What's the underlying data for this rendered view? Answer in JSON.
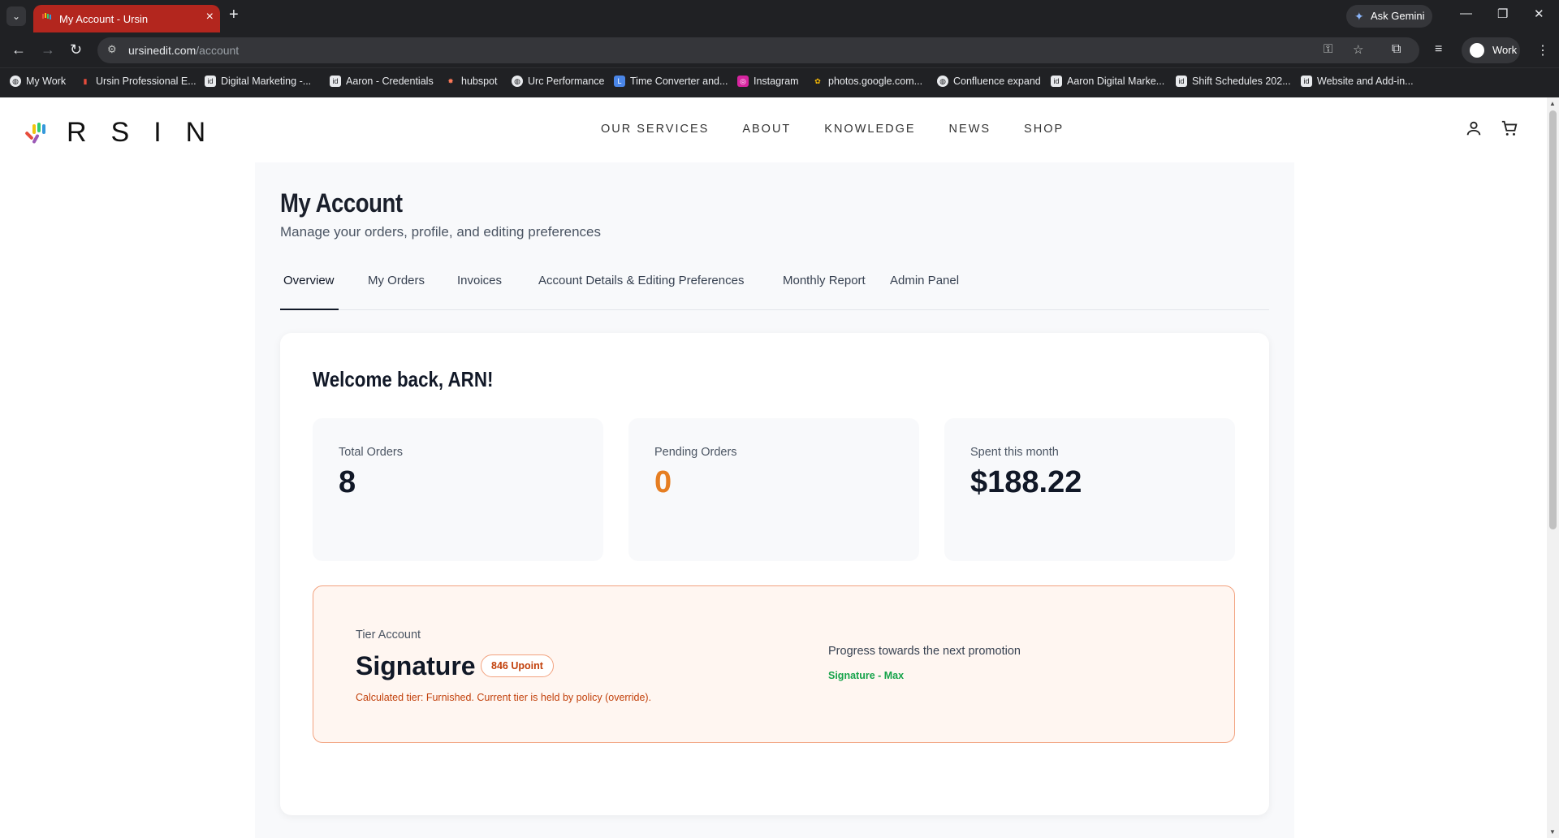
{
  "browser": {
    "tab_title": "My Account - Ursin",
    "ask_gemini": "Ask Gemini",
    "url_host": "ursinedit.com",
    "url_path": "/account",
    "profile_name": "Work",
    "bookmarks": [
      {
        "label": "My Work",
        "icon": "globe-icon"
      },
      {
        "label": "Ursin Professional E...",
        "icon": "ursin-icon"
      },
      {
        "label": "Digital Marketing -...",
        "icon": "doc-icon"
      },
      {
        "label": "Aaron - Credentials",
        "icon": "doc-icon"
      },
      {
        "label": "hubspot",
        "icon": "hubspot-icon"
      },
      {
        "label": "Urc Performance",
        "icon": "globe-icon"
      },
      {
        "label": "Time Converter and...",
        "icon": "clock-icon"
      },
      {
        "label": "Instagram",
        "icon": "instagram-icon"
      },
      {
        "label": "photos.google.com...",
        "icon": "photos-icon"
      },
      {
        "label": "Confluence expand",
        "icon": "globe-icon"
      },
      {
        "label": "Aaron Digital Marke...",
        "icon": "doc-icon"
      },
      {
        "label": "Shift Schedules 202...",
        "icon": "doc-icon"
      },
      {
        "label": "Website and Add-in...",
        "icon": "doc-icon"
      }
    ]
  },
  "site": {
    "logo_text": "RSIN",
    "nav": [
      "OUR SERVICES",
      "ABOUT",
      "KNOWLEDGE",
      "NEWS",
      "SHOP"
    ]
  },
  "account": {
    "title": "My Account",
    "subtitle": "Manage your orders, profile, and editing preferences",
    "tabs": [
      "Overview",
      "My Orders",
      "Invoices",
      "Account Details & Editing Preferences",
      "Monthly Report",
      "Admin Panel"
    ],
    "active_tab": "Overview",
    "welcome": "Welcome back, ARN!",
    "stats": [
      {
        "label": "Total Orders",
        "value": "8"
      },
      {
        "label": "Pending Orders",
        "value": "0",
        "color": "#e67e22"
      },
      {
        "label": "Spent this month",
        "value": "$188.22"
      }
    ],
    "tier": {
      "label": "Tier Account",
      "name": "Signature",
      "badge": "846 Upoint",
      "note": "Calculated tier: Furnished. Current tier is held by policy (override).",
      "progress_label": "Progress towards the next promotion",
      "progress_path": "Signature - Max"
    }
  }
}
